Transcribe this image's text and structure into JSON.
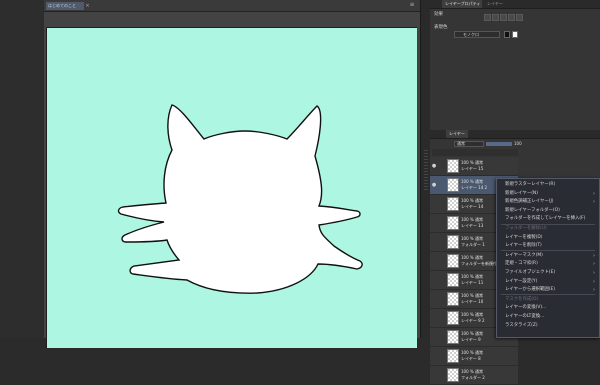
{
  "document_tab": {
    "title": "はじめてのこと",
    "close": "×"
  },
  "tabbar": {
    "menu": "≡"
  },
  "canvas": {
    "background": "#adf7e2",
    "fill": "#ffffff",
    "outline": "#111111"
  },
  "right_panel": {
    "property_tab": "レイヤープロパティ",
    "other_tab": "レイヤー",
    "effect_title": "効果",
    "expression_color_label": "表現色",
    "expression_color_value": "モノクロ",
    "layer_tab": "レイヤー",
    "blend_mode": "通常",
    "opacity": "100"
  },
  "layers": [
    {
      "line1": "100 % 通常",
      "line2": "レイヤー 15",
      "selected": false,
      "eye": "●"
    },
    {
      "line1": "100 % 通常",
      "line2": "レイヤー 14 2",
      "selected": true,
      "eye": "●"
    },
    {
      "line1": "100 % 通常",
      "line2": "レイヤー 14",
      "selected": false,
      "eye": ""
    },
    {
      "line1": "100 % 通常",
      "line2": "レイヤー 13",
      "selected": false,
      "eye": ""
    },
    {
      "line1": "100 % 通常",
      "line2": "フォルダー 1",
      "selected": false,
      "eye": ""
    },
    {
      "line1": "100 % 通常",
      "line2": "フォルダーを新規作成",
      "selected": false,
      "eye": ""
    },
    {
      "line1": "100 % 通常",
      "line2": "レイヤー 11",
      "selected": false,
      "eye": ""
    },
    {
      "line1": "100 % 通常",
      "line2": "レイヤー 10",
      "selected": false,
      "eye": ""
    },
    {
      "line1": "100 % 通常",
      "line2": "レイヤー 9 2",
      "selected": false,
      "eye": ""
    },
    {
      "line1": "100 % 通常",
      "line2": "レイヤー 9",
      "selected": false,
      "eye": ""
    },
    {
      "line1": "100 % 通常",
      "line2": "レイヤー 8",
      "selected": false,
      "eye": ""
    },
    {
      "line1": "100 % 通常",
      "line2": "フォルダー 2",
      "selected": false,
      "eye": ""
    }
  ],
  "context_menu": [
    {
      "label": "新規ラスターレイヤー(R)",
      "arrow": "",
      "disabled": false
    },
    {
      "label": "新規レイヤー(N)",
      "arrow": "›",
      "disabled": false
    },
    {
      "label": "新規色調補正レイヤー(J)",
      "arrow": "›",
      "disabled": false
    },
    {
      "label": "新規レイヤーフォルダー(O)",
      "arrow": "",
      "disabled": false
    },
    {
      "label": "フォルダーを作成してレイヤーを挿入(F)",
      "arrow": "",
      "disabled": false
    },
    {
      "label": "フォルダーを解除(U)",
      "arrow": "",
      "disabled": true
    },
    {
      "label": "レイヤーを複製(D)",
      "arrow": "",
      "disabled": false
    },
    {
      "label": "レイヤーを削除(T)",
      "arrow": "",
      "disabled": false
    },
    {
      "label": "レイヤーマスク(M)",
      "arrow": "›",
      "disabled": false
    },
    {
      "label": "定規・コマ枠(R)",
      "arrow": "›",
      "disabled": false
    },
    {
      "label": "ファイルオブジェクト(E)",
      "arrow": "›",
      "disabled": false
    },
    {
      "label": "レイヤー設定(Y)",
      "arrow": "›",
      "disabled": false
    },
    {
      "label": "レイヤーから選択範囲(E)",
      "arrow": "›",
      "disabled": false
    },
    {
      "label": "マスクを作成(O)",
      "arrow": "",
      "disabled": true
    },
    {
      "label": "レイヤーの変換(V)...",
      "arrow": "",
      "disabled": false
    },
    {
      "label": "レイヤーのLT変換...",
      "arrow": "",
      "disabled": false
    },
    {
      "label": "ラスタライズ(Z)",
      "arrow": "",
      "disabled": false
    }
  ]
}
